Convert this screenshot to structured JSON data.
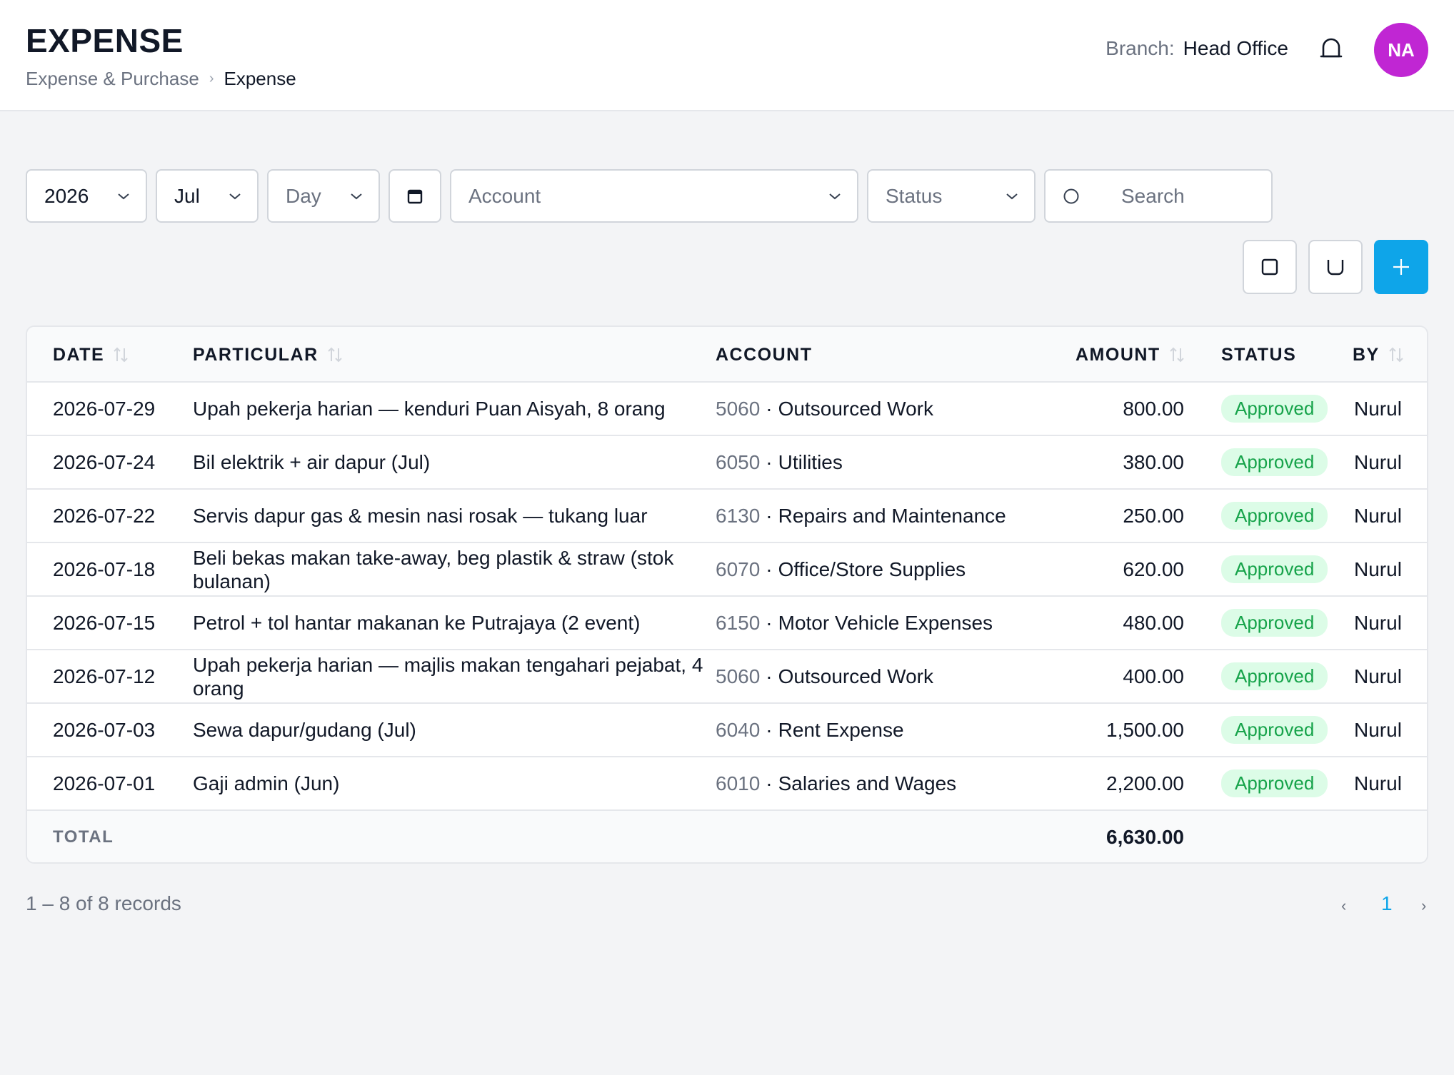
{
  "header": {
    "title": "EXPENSE",
    "breadcrumb": [
      {
        "label": "Expense & Purchase"
      },
      {
        "label": "Expense"
      }
    ],
    "breadcrumb_separator": "›",
    "branch_label": "Branch:",
    "branch_value": "Head Office",
    "avatar_initials": "NA"
  },
  "filters": {
    "year": "2026",
    "month": "Jul",
    "day_placeholder": "Day",
    "account_placeholder": "Account",
    "status_placeholder": "Status",
    "search_placeholder": "Search"
  },
  "toolbar": {
    "add_label": "+"
  },
  "table": {
    "columns": {
      "date": "DATE",
      "particular": "PARTICULAR",
      "account": "ACCOUNT",
      "amount": "AMOUNT",
      "status": "STATUS",
      "by": "BY"
    },
    "rows": [
      {
        "date": "2026-07-29",
        "particular": "Upah pekerja harian — kenduri Puan Aisyah, 8 orang",
        "account_code": "5060",
        "account_name": "Outsourced Work",
        "amount": "800.00",
        "status": "Approved",
        "by": "Nurul"
      },
      {
        "date": "2026-07-24",
        "particular": "Bil elektrik + air dapur (Jul)",
        "account_code": "6050",
        "account_name": "Utilities",
        "amount": "380.00",
        "status": "Approved",
        "by": "Nurul"
      },
      {
        "date": "2026-07-22",
        "particular": "Servis dapur gas & mesin nasi rosak — tukang luar",
        "account_code": "6130",
        "account_name": "Repairs and Maintenance",
        "amount": "250.00",
        "status": "Approved",
        "by": "Nurul"
      },
      {
        "date": "2026-07-18",
        "particular": "Beli bekas makan take-away, beg plastik & straw (stok bulanan)",
        "account_code": "6070",
        "account_name": "Office/Store Supplies",
        "amount": "620.00",
        "status": "Approved",
        "by": "Nurul"
      },
      {
        "date": "2026-07-15",
        "particular": "Petrol + tol hantar makanan ke Putrajaya (2 event)",
        "account_code": "6150",
        "account_name": "Motor Vehicle Expenses",
        "amount": "480.00",
        "status": "Approved",
        "by": "Nurul"
      },
      {
        "date": "2026-07-12",
        "particular": "Upah pekerja harian — majlis makan tengahari pejabat, 4 orang",
        "account_code": "5060",
        "account_name": "Outsourced Work",
        "amount": "400.00",
        "status": "Approved",
        "by": "Nurul"
      },
      {
        "date": "2026-07-03",
        "particular": "Sewa dapur/gudang (Jul)",
        "account_code": "6040",
        "account_name": "Rent Expense",
        "amount": "1,500.00",
        "status": "Approved",
        "by": "Nurul"
      },
      {
        "date": "2026-07-01",
        "particular": "Gaji admin (Jun)",
        "account_code": "6010",
        "account_name": "Salaries and Wages",
        "amount": "2,200.00",
        "status": "Approved",
        "by": "Nurul"
      }
    ],
    "total_label": "TOTAL",
    "total_amount": "6,630.00"
  },
  "pagination": {
    "records_text": "1 – 8 of 8 records",
    "prev": "‹",
    "current_page": "1",
    "next": "›"
  },
  "colors": {
    "accent": "#0ea5e9",
    "avatar": "#c026d3",
    "approved_text": "#16a34a",
    "approved_bg": "#dcfce7"
  }
}
